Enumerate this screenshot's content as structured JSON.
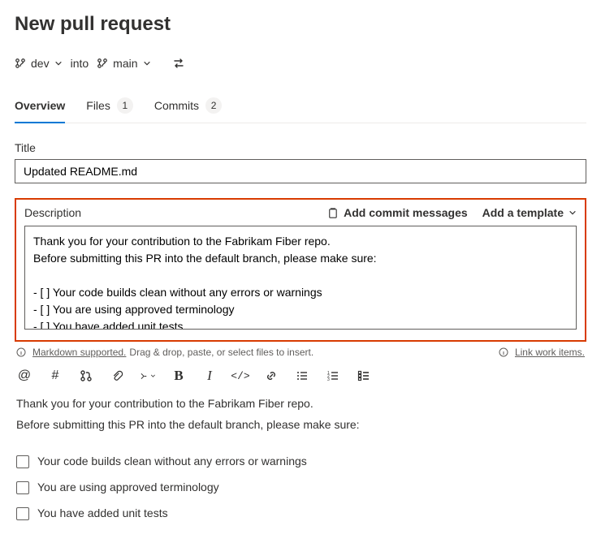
{
  "page_title": "New pull request",
  "branches": {
    "source": "dev",
    "into_label": "into",
    "target": "main"
  },
  "tabs": [
    {
      "key": "overview",
      "label": "Overview",
      "count": null,
      "active": true
    },
    {
      "key": "files",
      "label": "Files",
      "count": "1",
      "active": false
    },
    {
      "key": "commits",
      "label": "Commits",
      "count": "2",
      "active": false
    }
  ],
  "title_field": {
    "label": "Title",
    "value": "Updated README.md"
  },
  "description": {
    "label": "Description",
    "add_commits_label": "Add commit messages",
    "add_template_label": "Add a template",
    "value": "Thank you for your contribution to the Fabrikam Fiber repo.\nBefore submitting this PR into the default branch, please make sure:\n\n- [ ] Your code builds clean without any errors or warnings\n- [ ] You are using approved terminology\n- [ ] You have added unit tests"
  },
  "hints": {
    "markdown_link": "Markdown supported.",
    "drag_text": " Drag & drop, paste, or select files to insert.",
    "link_work_items": "Link work items."
  },
  "preview": {
    "line1": "Thank you for your contribution to the Fabrikam Fiber repo.",
    "line2": "Before submitting this PR into the default branch, please make sure:",
    "checks": [
      "Your code builds clean without any errors or warnings",
      "You are using approved terminology",
      "You have added unit tests"
    ]
  }
}
